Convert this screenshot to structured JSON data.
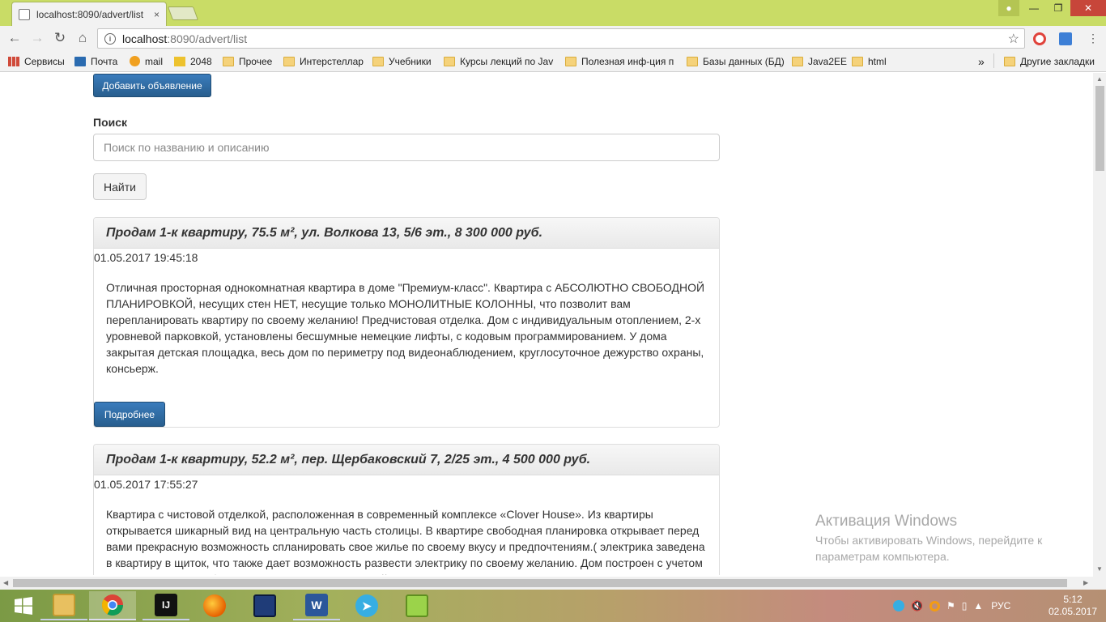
{
  "browser": {
    "tab_title": "localhost:8090/advert/list",
    "tab_close": "×",
    "url_host": "localhost",
    "url_path": ":8090/advert/list"
  },
  "bookmarks": [
    {
      "label": "Сервисы",
      "icon": "apps-grid-icon"
    },
    {
      "label": "Почта",
      "icon": "mail-icon"
    },
    {
      "label": "mail",
      "icon": "mail-at-icon"
    },
    {
      "label": "2048",
      "icon": "game-2048-icon"
    },
    {
      "label": "Прочее",
      "icon": "folder-icon"
    },
    {
      "label": "Интерстеллар",
      "icon": "folder-icon"
    },
    {
      "label": "Учебники",
      "icon": "folder-icon"
    },
    {
      "label": "Курсы лекций по Jav",
      "icon": "folder-icon"
    },
    {
      "label": "Полезная инф-ция п",
      "icon": "folder-icon"
    },
    {
      "label": "Базы данных (БД)",
      "icon": "folder-icon"
    },
    {
      "label": "Java2EE",
      "icon": "folder-icon"
    },
    {
      "label": "html",
      "icon": "folder-icon"
    }
  ],
  "bookmarks_more": "»",
  "other_bookmarks": "Другие закладки",
  "page": {
    "add_button": "Добавить объявление",
    "search_label": "Поиск",
    "search_placeholder": "Поиск по названию и описанию",
    "find_button": "Найти",
    "details_button": "Подробнее",
    "adverts": [
      {
        "title": "Продам 1-к квартиру, 75.5 м², ул. Волкова 13, 5/6 эт., 8 300 000 руб.",
        "date": "01.05.2017 19:45:18",
        "body": "Отличная просторная однокомнатная квартира в доме \"Премиум-класс\". Квартира с АБСОЛЮТНО СВОБОДНОЙ ПЛАНИРОВКОЙ, несущих стен НЕТ, несущие только МОНОЛИТНЫЕ КОЛОННЫ, что позволит вам перепланировать квартиру по своему желанию! Предчистовая отделка. Дом с индивидуальным отоплением, 2-х уровневой парковкой, установлены бесшумные немецкие лифты, с кодовым программированием. У дома закрытая детская площадка, весь дом по периметру под видеонаблюдением, круглосуточное дежурство охраны, консьерж."
      },
      {
        "title": "Продам 1-к квартиру, 52.2 м², пер. Щербаковский 7, 2/25 эт., 4 500 000 руб.",
        "date": "01.05.2017 17:55:27",
        "body": "Квартира с чистовой отделкой, расположенная в современный комплексе «Clover House». Из квартиры открывается шикарный вид на центральную часть столицы. В квартире свободная планировка открывает перед вами прекрасную возможность спланировать свое жилье по своему вкусу и предпочтениям.( электрика заведена в квартиру в щиток, что также дает возможность развести электрику по своему желанию. Дом построен с учетом всех современных, безопасных шведских технологий, оснащен современными грузовыми и"
      }
    ]
  },
  "watermark": {
    "title": "Активация Windows",
    "line1": "Чтобы активировать Windows, перейдите к",
    "line2": "параметрам компьютера."
  },
  "taskbar": {
    "language": "РУС",
    "time": "5:12",
    "date": "02.05.2017"
  },
  "colors": {
    "chrome_frame": "#c9dc66",
    "primary_button": "#2e6da4"
  }
}
